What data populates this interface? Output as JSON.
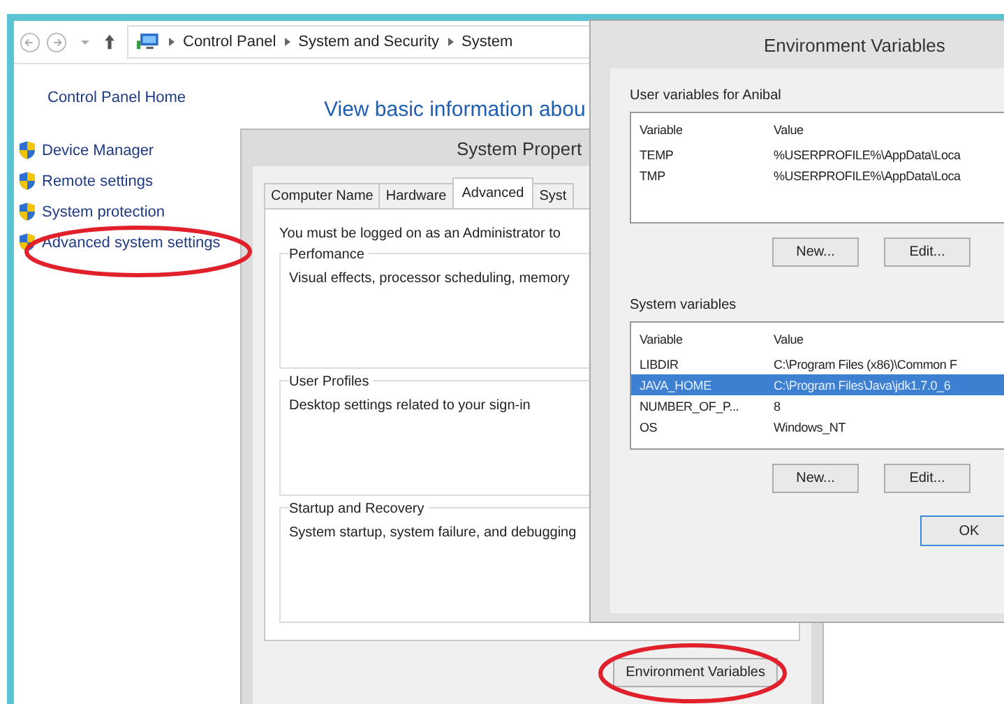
{
  "address_bar": {
    "breadcrumbs": [
      "Control Panel",
      "System and Security",
      "System"
    ]
  },
  "sidebar": {
    "home_link": "Control Panel Home",
    "items": [
      {
        "label": "Device Manager"
      },
      {
        "label": "Remote settings"
      },
      {
        "label": "System protection"
      },
      {
        "label": "Advanced system settings"
      }
    ]
  },
  "main": {
    "heading": "View basic information abou"
  },
  "system_properties": {
    "title": "System Propert",
    "tabs": [
      {
        "label": "Computer Name",
        "selected": false
      },
      {
        "label": "Hardware",
        "selected": false
      },
      {
        "label": "Advanced",
        "selected": true
      },
      {
        "label": "Syst",
        "selected": false
      }
    ],
    "admin_note": "You must be logged on as an Administrator to",
    "groups": [
      {
        "title": "Perfomance",
        "description": "Visual effects, processor scheduling, memory"
      },
      {
        "title": "User Profiles",
        "description": "Desktop settings related to your sign-in"
      },
      {
        "title": "Startup and Recovery",
        "description": "System startup, system failure, and debugging"
      }
    ],
    "environment_button": "Environment Variables"
  },
  "environment_variables": {
    "title": "Environment Variables",
    "sections": [
      {
        "label": "User variables for Anibal",
        "columns": [
          "Variable",
          "Value"
        ],
        "rows": [
          {
            "variable": "TEMP",
            "value": "%USERPROFILE%\\AppData\\Loca",
            "selected": false
          },
          {
            "variable": "TMP",
            "value": "%USERPROFILE%\\AppData\\Loca",
            "selected": false
          }
        ],
        "buttons": [
          "New...",
          "Edit..."
        ]
      },
      {
        "label": "System variables",
        "columns": [
          "Variable",
          "Value"
        ],
        "rows": [
          {
            "variable": "LIBDIR",
            "value": "C:\\Program Files (x86)\\Common F",
            "selected": false
          },
          {
            "variable": "JAVA_HOME",
            "value": "C:\\Program Files\\Java\\jdk1.7.0_6",
            "selected": true
          },
          {
            "variable": "NUMBER_OF_P...",
            "value": "8",
            "selected": false
          },
          {
            "variable": "OS",
            "value": "Windows_NT",
            "selected": false
          }
        ],
        "buttons": [
          "New...",
          "Edit..."
        ]
      }
    ],
    "ok_button": "OK"
  }
}
